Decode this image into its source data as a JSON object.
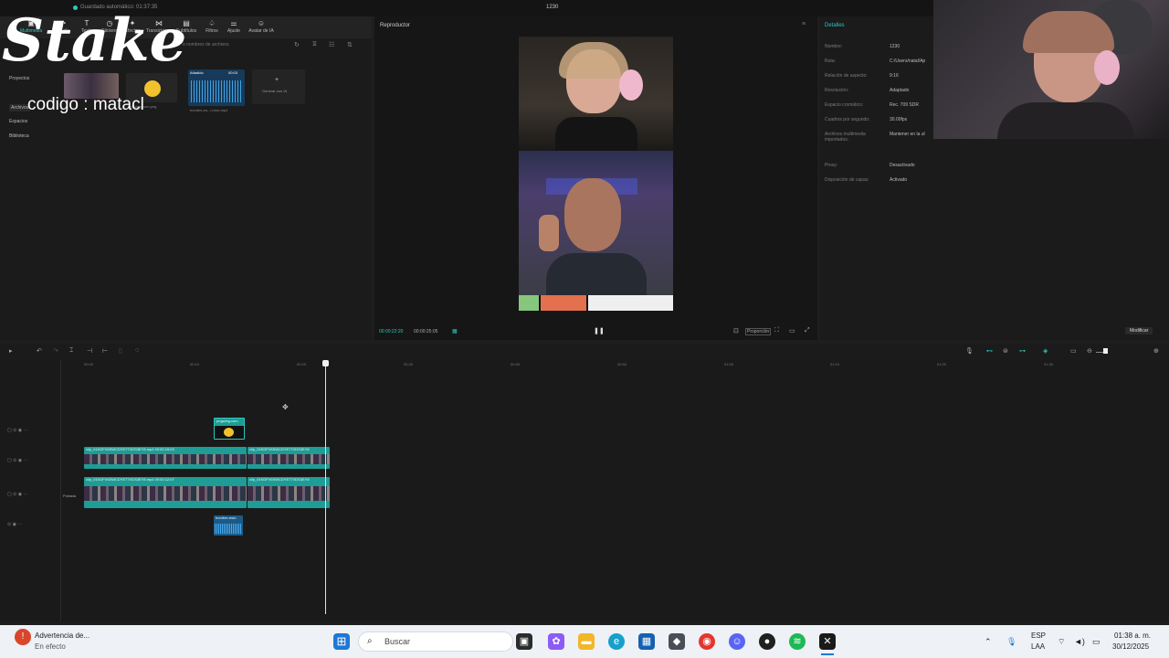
{
  "topbar": {
    "autosave": "Guardado automático: 01:37:35",
    "project_name": "1230"
  },
  "toolbar": {
    "items": [
      {
        "label": "Multimedia",
        "icon": "media-icon"
      },
      {
        "label": "Audio",
        "icon": "audio-icon"
      },
      {
        "label": "Texto",
        "icon": "text-icon"
      },
      {
        "label": "Stickers",
        "icon": "sticker-icon"
      },
      {
        "label": "Efectos",
        "icon": "effects-icon"
      },
      {
        "label": "Transiciones",
        "icon": "transition-icon"
      },
      {
        "label": "Subtítulos",
        "icon": "subtitle-icon"
      },
      {
        "label": "Filtros",
        "icon": "filter-icon"
      },
      {
        "label": "Ajuste",
        "icon": "adjust-icon"
      },
      {
        "label": "Avatar de IA",
        "icon": "avatar-icon"
      }
    ]
  },
  "overlay": {
    "brand": "Stake",
    "code": "codigo : matacl"
  },
  "media": {
    "search_placeholder": "o nombres de archivos",
    "sidebar": [
      "Proyectos",
      "Archivos",
      "Espacios",
      "Biblioteca"
    ],
    "cards": [
      {
        "name": "pngwing.com.png"
      },
      {
        "name": "hombre-es...n-hac.mp4",
        "badge": "Añadido",
        "duration": "00:03"
      },
      {
        "name": "Generar con IA"
      }
    ]
  },
  "player": {
    "title": "Reproductor",
    "current_time": "00:00:22:20",
    "total_time": "00:00:25:05",
    "ratio_label": "Proporción"
  },
  "details": {
    "title": "Detalles",
    "rows": [
      {
        "label": "Nombre:",
        "value": "1230"
      },
      {
        "label": "Ruta:",
        "value": "C:/Users/natal/Ap"
      },
      {
        "label": "Relación de aspecto:",
        "value": "9:16"
      },
      {
        "label": "Resolución:",
        "value": "Adaptado"
      },
      {
        "label": "Espacio cromático:",
        "value": "Rec. 709 SDR"
      },
      {
        "label": "Cuadros por segundo:",
        "value": "30.00fps"
      },
      {
        "label": "Archivos multimedia importados:",
        "value": "Mantener en la ul"
      },
      {
        "label": "Proxy:",
        "value": "Desactivado"
      },
      {
        "label": "Disposición de capas:",
        "value": "Activado"
      }
    ],
    "modify_button": "Modificar"
  },
  "timeline": {
    "ruler": [
      "00:00",
      "00:10",
      "00:20",
      "00:30",
      "00:40",
      "00:50",
      "01:00",
      "01:10",
      "01:20",
      "01:30"
    ],
    "sticker_clip": "pngwing.com",
    "video_clip_a": "clip_01KDFV6SWCDYE77VDS3EY8.mp4  00:00:15:03",
    "video_clip_b": "clip_01KDFV6SWCDYE77VDS3EY8",
    "main_clip_a": "clip_01KDFV6SWCDYE77VDS3EY8.mp4  00:00:12:07",
    "main_clip_b": "clip_01KDFV6SWCDYE77VDS3EY8",
    "audio_clip": "hombre-esto",
    "cover_label": "Portada"
  },
  "taskbar": {
    "notification_title": "Advertencia de...",
    "notification_sub": "En efecto",
    "search": "Buscar",
    "lang_top": "ESP",
    "lang_bottom": "LAA",
    "time": "01:38 a. m.",
    "date": "30/12/2025"
  },
  "colors": {
    "accent": "#2bc8c0",
    "clip": "#1d9d95",
    "taskbar": "#eef1f6"
  }
}
